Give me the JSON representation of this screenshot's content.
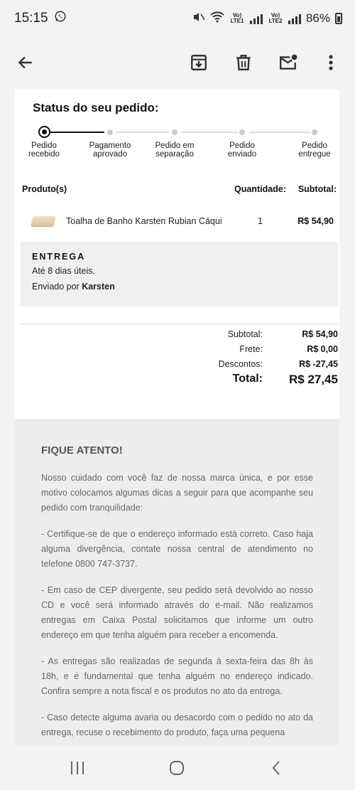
{
  "status_bar": {
    "time": "15:15",
    "battery": "86%",
    "sim1_label": "Vo) LTE1",
    "sim2_label": "Vo) LTE2"
  },
  "order": {
    "status_title": "Status do seu pedido:",
    "steps": [
      {
        "label_line1": "Pedido",
        "label_line2": "recebido"
      },
      {
        "label_line1": "Pagamento",
        "label_line2": "aprovado"
      },
      {
        "label_line1": "Pedido em",
        "label_line2": "separação"
      },
      {
        "label_line1": "Pedido",
        "label_line2": "enviado"
      },
      {
        "label_line1": "Pedido",
        "label_line2": "entregue"
      }
    ],
    "current_step": 1,
    "headers": {
      "product": "Produto(s)",
      "quantity": "Quantidade:",
      "subtotal": "Subtotal:"
    },
    "items": [
      {
        "name": "Toalha de Banho Karsten Rubian Cáqui",
        "quantity": "1",
        "subtotal": "R$ 54,90"
      }
    ],
    "delivery": {
      "label": "ENTREGA",
      "days": "Até 8 dias úteis.",
      "sent_by_prefix": "Enviado por ",
      "sent_by": "Karsten"
    },
    "totals": [
      {
        "label": "Subtotal:",
        "value": "R$ 54,90"
      },
      {
        "label": "Frete:",
        "value": "R$ 0,00"
      },
      {
        "label": "Descontos:",
        "value": "R$ -27,45"
      }
    ],
    "total": {
      "label": "Total:",
      "value": "R$ 27,45"
    }
  },
  "notice": {
    "title": "FIQUE ATENTO!",
    "paragraphs": [
      "Nosso cuidado com você faz de nossa marca única, e por esse motivo colocamos algumas dicas a seguir para que acompanhe seu pedido com tranquilidade:",
      "- Certifique-se de que o endereço informado está correto. Caso haja alguma divergência, contate nossa central de atendimento no telefone 0800 747-3737.",
      "- Em caso de CEP divergente, seu pedido será devolvido ao nosso CD e você será informado através do e-mail. Não realizamos entregas em Caixa Postal solicitamos que informe um outro endereço em que tenha alguém para receber a encomenda.",
      "- As entregas são realizadas de segunda à sexta-feira das 8h às 18h, e é fundamental que tenha alguém no endereço indicado. Confira sempre a nota fiscal e os produtos no ato da entrega.",
      "- Caso detecte alguma avaria ou desacordo com o pedido no ato da entrega, recuse o recebimento do produto, faça uma pequena"
    ]
  },
  "icons": {
    "back": "arrow-left-icon",
    "archive": "archive-icon",
    "delete": "trash-icon",
    "mark_unread": "mail-unread-icon",
    "more": "more-vertical-icon"
  }
}
